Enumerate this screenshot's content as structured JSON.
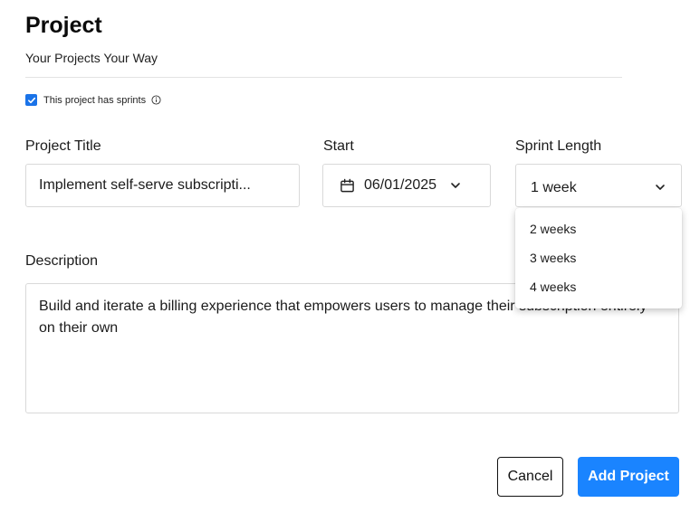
{
  "header": {
    "title": "Project",
    "subtitle": "Your Projects Your Way"
  },
  "sprints": {
    "label": "This project has sprints",
    "checked": true
  },
  "fields": {
    "project_title": {
      "label": "Project Title",
      "value": "Implement self-serve subscripti..."
    },
    "start": {
      "label": "Start",
      "value": "06/01/2025"
    },
    "sprint_length": {
      "label": "Sprint Length",
      "value": "1 week",
      "options": [
        "2 weeks",
        "3 weeks",
        "4 weeks"
      ]
    },
    "description": {
      "label": "Description",
      "value": "Build and iterate a billing experience that empowers users to manage their subscription entirely on their own"
    }
  },
  "actions": {
    "cancel_label": "Cancel",
    "add_label": "Add Project"
  },
  "colors": {
    "accent": "#1a84ff",
    "checkbox": "#1a73e8",
    "border": "#d9d9d9"
  },
  "icons": {
    "calendar": "calendar-icon",
    "chevron": "chevron-down-icon",
    "info": "info-icon",
    "check": "check-icon"
  }
}
